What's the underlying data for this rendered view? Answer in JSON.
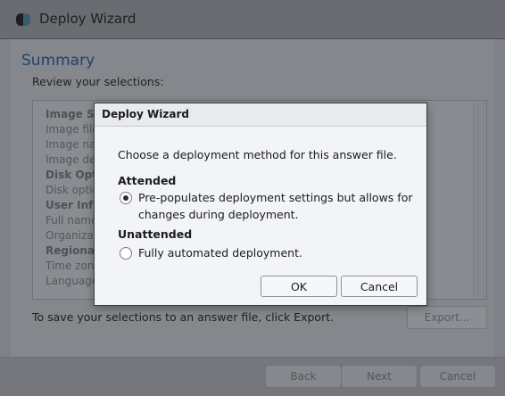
{
  "window": {
    "title": "Deploy Wizard"
  },
  "summary": {
    "title": "Summary",
    "subtitle": "Review your selections:",
    "items": [
      {
        "label": "Image Sel",
        "head": true
      },
      {
        "label": "Image file:",
        "head": false
      },
      {
        "label": "Image nam",
        "head": false
      },
      {
        "label": "Image des",
        "head": false
      },
      {
        "label": "Disk Optio",
        "head": true
      },
      {
        "label": "Disk option",
        "head": false
      },
      {
        "label": "User Infor",
        "head": true
      },
      {
        "label": "Full name:",
        "head": false
      },
      {
        "label": "Organizati",
        "head": false
      },
      {
        "label": "Regional S",
        "head": true
      },
      {
        "label": "Time zone",
        "head": false
      },
      {
        "label": "Language",
        "head": false
      }
    ],
    "export_hint": "To save your selections to an answer file, click Export.",
    "export_label": "Export..."
  },
  "footer": {
    "back_label": "Back",
    "next_label": "Next",
    "cancel_label": "Cancel"
  },
  "dialog": {
    "title": "Deploy Wizard",
    "message": "Choose a deployment method for this answer file.",
    "attended": {
      "heading": "Attended",
      "line1": "Pre-populates deployment settings but allows for",
      "line2": "changes during deployment.",
      "selected": true
    },
    "unattended": {
      "heading": "Unattended",
      "text": "Fully automated deployment.",
      "selected": false
    },
    "ok_label": "OK",
    "cancel_label": "Cancel"
  }
}
